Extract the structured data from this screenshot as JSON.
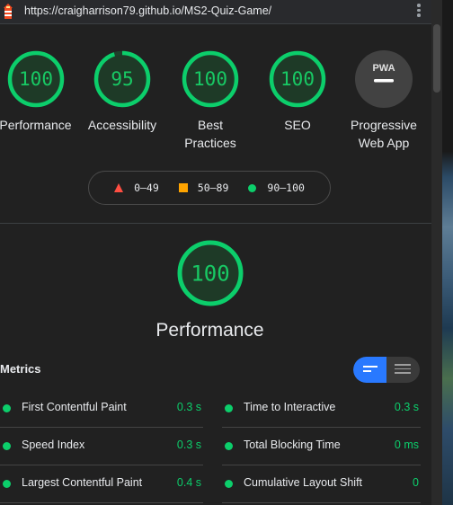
{
  "address_bar": {
    "url": "https://craigharrison79.github.io/MS2-Quiz-Game/"
  },
  "categories": [
    {
      "score": "100",
      "label": "Performance",
      "status": "pass"
    },
    {
      "score": "95",
      "label": "Accessibility",
      "status": "pass"
    },
    {
      "score": "100",
      "label": "Best Practices",
      "status": "pass"
    },
    {
      "score": "100",
      "label": "SEO",
      "status": "pass"
    },
    {
      "score": "",
      "badge": "PWA",
      "label": "Progressive Web App",
      "status": "na"
    }
  ],
  "legend": [
    {
      "range": "0–49",
      "shape": "triangle",
      "color": "#ff4e42"
    },
    {
      "range": "50–89",
      "shape": "square",
      "color": "#ffa400"
    },
    {
      "range": "90–100",
      "shape": "circle",
      "color": "#0cce6b"
    }
  ],
  "performance": {
    "score": "100",
    "title": "Performance"
  },
  "metrics": {
    "title": "Metrics",
    "items": [
      {
        "label": "First Contentful Paint",
        "value": "0.3 s"
      },
      {
        "label": "Time to Interactive",
        "value": "0.3 s"
      },
      {
        "label": "Speed Index",
        "value": "0.3 s"
      },
      {
        "label": "Total Blocking Time",
        "value": "0 ms"
      },
      {
        "label": "Largest Contentful Paint",
        "value": "0.4 s"
      },
      {
        "label": "Cumulative Layout Shift",
        "value": "0"
      }
    ]
  },
  "colors": {
    "pass": "#0cce6b",
    "average": "#ffa400",
    "fail": "#ff4e42",
    "accent": "#2979ff"
  }
}
